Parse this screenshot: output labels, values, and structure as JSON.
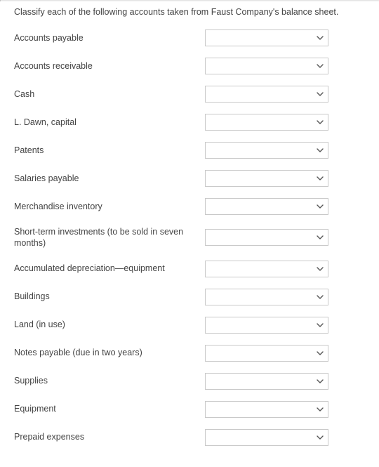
{
  "instruction": "Classify each of the following accounts taken from Faust Company's balance sheet.",
  "rows": [
    {
      "label": "Accounts payable"
    },
    {
      "label": "Accounts receivable"
    },
    {
      "label": "Cash"
    },
    {
      "label": "L. Dawn, capital"
    },
    {
      "label": "Patents"
    },
    {
      "label": "Salaries payable"
    },
    {
      "label": "Merchandise inventory"
    },
    {
      "label": "Short-term investments (to be sold in seven months)"
    },
    {
      "label": "Accumulated depreciation—equipment"
    },
    {
      "label": "Buildings"
    },
    {
      "label": "Land (in use)"
    },
    {
      "label": "Notes payable (due in two years)"
    },
    {
      "label": "Supplies"
    },
    {
      "label": "Equipment"
    },
    {
      "label": "Prepaid expenses"
    }
  ]
}
